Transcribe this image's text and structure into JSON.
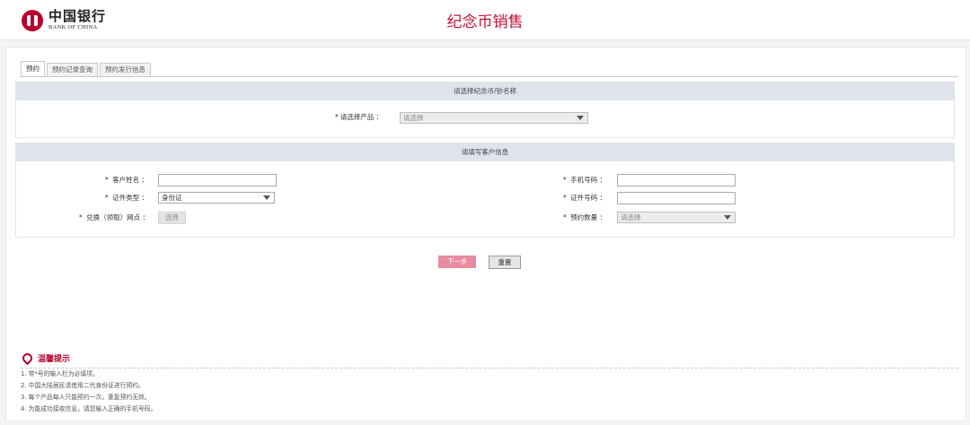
{
  "header": {
    "logo_cn": "中国银行",
    "logo_en": "BANK OF CHINA",
    "title": "纪念币销售"
  },
  "tabs": [
    {
      "label": "预约",
      "active": true
    },
    {
      "label": "预约记录查询",
      "active": false
    },
    {
      "label": "预约发行信息",
      "active": false
    }
  ],
  "product_section": {
    "title": "请选择纪念币/钞名称",
    "product_label": "请选择产品",
    "product_value": "请选择"
  },
  "customer_section": {
    "title": "请填写客户信息",
    "name_label": "客户姓名",
    "name_value": "",
    "id_type_label": "证件类型",
    "id_type_value": "身份证",
    "branch_label": "兑换（领取）网点",
    "branch_button": "选择",
    "phone_label": "手机号码",
    "phone_value": "",
    "id_number_label": "证件号码",
    "id_number_value": "",
    "quantity_label": "预约数量",
    "quantity_value": "请选择"
  },
  "actions": {
    "next_label": "下一步",
    "reset_label": "重置"
  },
  "tips": {
    "title": "温馨提示",
    "items": [
      "1. 带*号的输入栏为必填项。",
      "2. 中国大陆居民请使用二代身份证进行预约。",
      "3. 每个产品每人只能预约一次，重复预约无效。",
      "4. 为能成功接收信息，请您输入正确的手机号码。"
    ]
  },
  "colors": {
    "brand": "#c3123a",
    "section_header": "#dfe4ec",
    "primary_button": "#e88aa0"
  }
}
